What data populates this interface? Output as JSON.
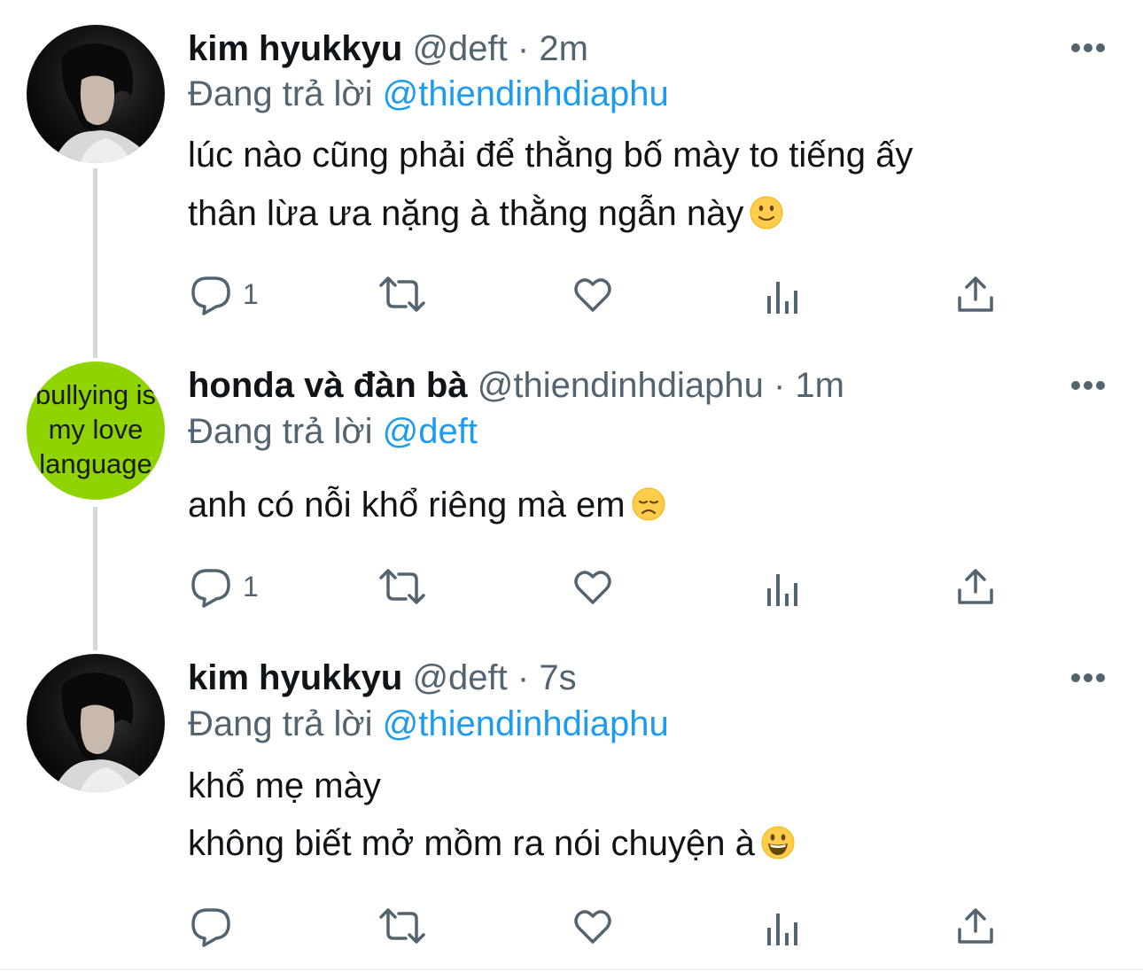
{
  "reply_prefix": "Đang trả lời",
  "tweets": [
    {
      "name": "kim hyukkyu",
      "handle": "@deft",
      "separator": "·",
      "time": "2m",
      "replying_to": "@thiendinhdiaphu",
      "lines": [
        "lúc nào cũng phải để thằng bố mày to tiếng ấy",
        "thân lừa ưa nặng à thằng ngẫn này"
      ],
      "emoji": "slightly-smiling-face",
      "reply_count": "1",
      "avatar": "dark-portrait"
    },
    {
      "name": "honda và đàn bà",
      "handle": "@thiendinhdiaphu",
      "separator": "·",
      "time": "1m",
      "replying_to": "@deft",
      "lines": [
        "anh có nỗi khổ riêng mà em"
      ],
      "emoji": "disappointed-face",
      "reply_count": "1",
      "avatar": "green-text-image",
      "avatar_text": [
        "bullying is",
        "my love",
        "language"
      ]
    },
    {
      "name": "kim hyukkyu",
      "handle": "@deft",
      "separator": "·",
      "time": "7s",
      "replying_to": "@thiendinhdiaphu",
      "lines": [
        "khổ mẹ mày",
        "không biết mở mồm ra nói chuyện à"
      ],
      "emoji": "grinning-face",
      "reply_count": "",
      "avatar": "dark-portrait"
    }
  ],
  "colors": {
    "text": "#0f1419",
    "secondary": "#536471",
    "link": "#1d9bf0",
    "thread_line": "#cfd9de",
    "avatar_green": "#8fd400"
  },
  "icons": [
    "reply-icon",
    "retweet-icon",
    "like-icon",
    "analytics-icon",
    "share-icon",
    "more-icon"
  ]
}
